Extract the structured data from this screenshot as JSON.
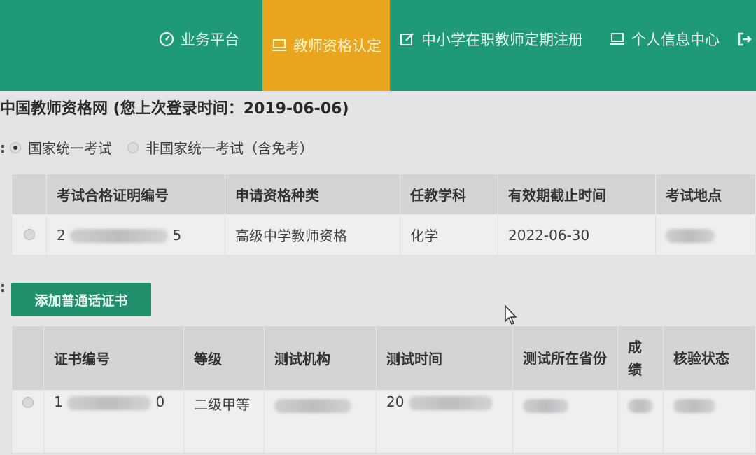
{
  "nav": {
    "items": [
      {
        "label": "业务平台",
        "icon": "dashboard-icon"
      },
      {
        "label": "教师资格认定",
        "icon": "monitor-icon",
        "active": true
      },
      {
        "label": "中小学在职教师定期注册",
        "icon": "edit-icon"
      },
      {
        "label": "个人信息中心",
        "icon": "monitor-icon"
      }
    ]
  },
  "page": {
    "title": "中国教师资格网 (您上次登录时间：2019-06-06)",
    "colon": ":"
  },
  "exam_type": {
    "options": [
      {
        "label": "国家统一考试",
        "checked": true
      },
      {
        "label": "非国家统一考试（含免考）",
        "checked": false
      }
    ]
  },
  "exam_table": {
    "headers": [
      "考试合格证明编号",
      "申请资格种类",
      "任教学科",
      "有效期截止时间",
      "考试地点"
    ],
    "rows": [
      {
        "cert_no_prefix": "2",
        "cert_no_suffix": "5",
        "type": "高级中学教师资格",
        "subject": "化学",
        "expiry": "2022-06-30"
      }
    ]
  },
  "mandarin": {
    "add_button": "添加普通话证书",
    "headers": [
      "证书编号",
      "等级",
      "测试机构",
      "测试时间",
      "测试所在省份",
      "成绩",
      "核验状态"
    ],
    "rows": [
      {
        "cert_no_prefix": "1",
        "cert_no_suffix": "0",
        "level": "二级甲等",
        "time_prefix": "20"
      }
    ]
  },
  "colors": {
    "nav_bg": "#1f9a78",
    "nav_active": "#e8a51d",
    "button_bg": "#1f8f6c"
  }
}
